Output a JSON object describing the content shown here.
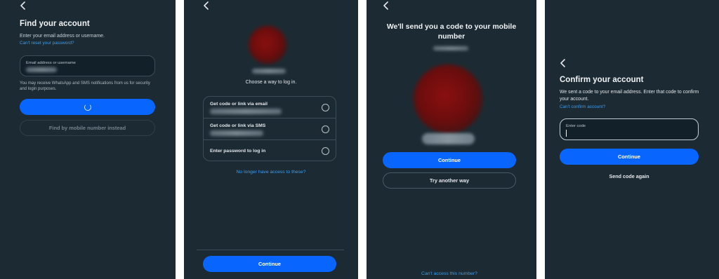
{
  "screen1": {
    "title": "Find your account",
    "instruction": "Enter your email address or username.",
    "reset_link": "Can't reset your password?",
    "input_label": "Email address or username",
    "notice": "You may receive WhatsApp and SMS notifications from us for security and login purposes.",
    "mobile_button": "Find by mobile number instead"
  },
  "screen2": {
    "prompt": "Choose a way to log in.",
    "options": [
      {
        "label": "Get code or link via email"
      },
      {
        "label": "Get code or link via SMS"
      },
      {
        "label": "Enter password to log in"
      }
    ],
    "no_access_link": "No longer have access to these?",
    "continue_button": "Continue"
  },
  "screen3": {
    "title": "We'll send you a code to your mobile number",
    "continue_button": "Continue",
    "try_another_button": "Try another way",
    "cant_access_link": "Can't access this number?"
  },
  "screen4": {
    "title": "Confirm your account",
    "instruction": "We sent a code to your email address. Enter that code to confirm your account.",
    "cant_confirm_link": "Can't confirm account?",
    "input_label": "Enter code",
    "continue_button": "Continue",
    "send_again_button": "Send code again"
  },
  "colors": {
    "background": "#1c2b33",
    "primary": "#0866ff",
    "link": "#3b9df0",
    "separator": "#ffffff"
  },
  "icons": {
    "back": "chevron-left-icon",
    "loading": "spinner-icon",
    "radio": "radio-empty-icon"
  }
}
